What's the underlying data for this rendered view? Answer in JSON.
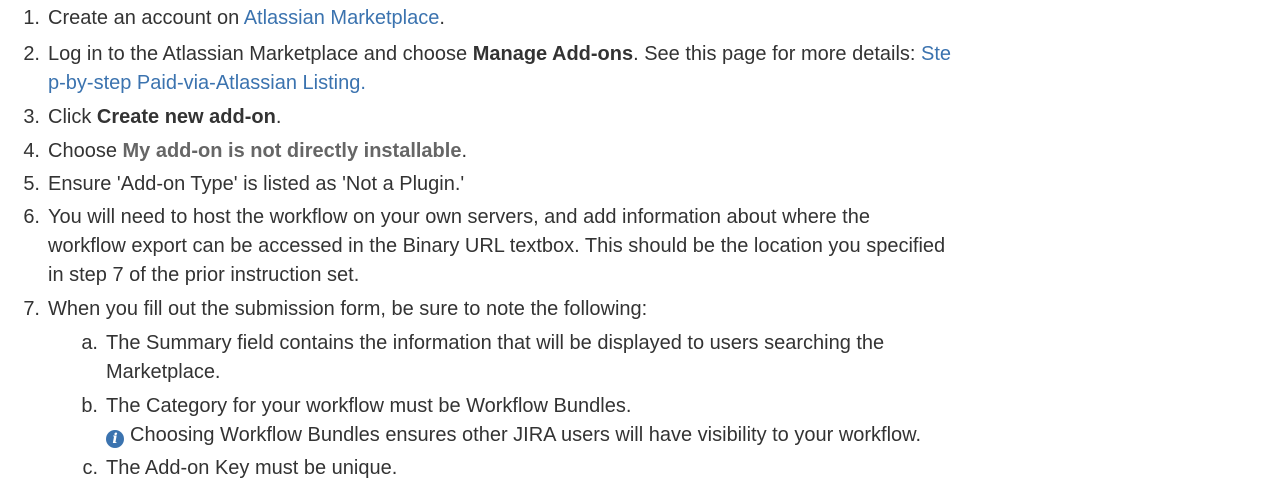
{
  "steps": [
    {
      "num": "1.",
      "pre": "Create an account on ",
      "link": "Atlassian Marketplace",
      "post": "."
    },
    {
      "num": "2.",
      "pre": "Log in to the Atlassian Marketplace and choose ",
      "bold": "Manage Add-ons",
      "mid": ". See this page for more details: ",
      "link_a": "Ste",
      "link_b": "p-by-step Paid-via-Atlassian Listing",
      "post": "."
    },
    {
      "num": "3.",
      "pre": "Click ",
      "bold": "Create new add-on",
      "post": "."
    },
    {
      "num": "4.",
      "pre": "Choose ",
      "bold": "My add-on is not directly installable",
      "post": "."
    },
    {
      "num": "5.",
      "text": "Ensure 'Add-on Type' is listed as 'Not a Plugin.'"
    },
    {
      "num": "6.",
      "line1": "You will need to host the workflow on your own servers, and add information about where the",
      "line2": "workflow export can be accessed in the Binary URL textbox. This should be the location you specified",
      "line3": "in step 7 of the prior instruction set."
    },
    {
      "num": "7.",
      "text": "When you fill out the submission form, be sure to note the following:"
    }
  ],
  "substeps": [
    {
      "num": "a.",
      "line1": "The Summary field contains the information that will be displayed to users searching the",
      "line2": "Marketplace."
    },
    {
      "num": "b.",
      "text": "The Category for your workflow must be Workflow Bundles.",
      "info": "Choosing Workflow Bundles ensures other JIRA users will have visibility to your workflow.",
      "info_icon": "info-icon"
    },
    {
      "num": "c.",
      "text": "The Add-on Key must be unique."
    }
  ],
  "colors": {
    "text": "#333333",
    "link": "#3b73af",
    "info": "#3b73af"
  }
}
